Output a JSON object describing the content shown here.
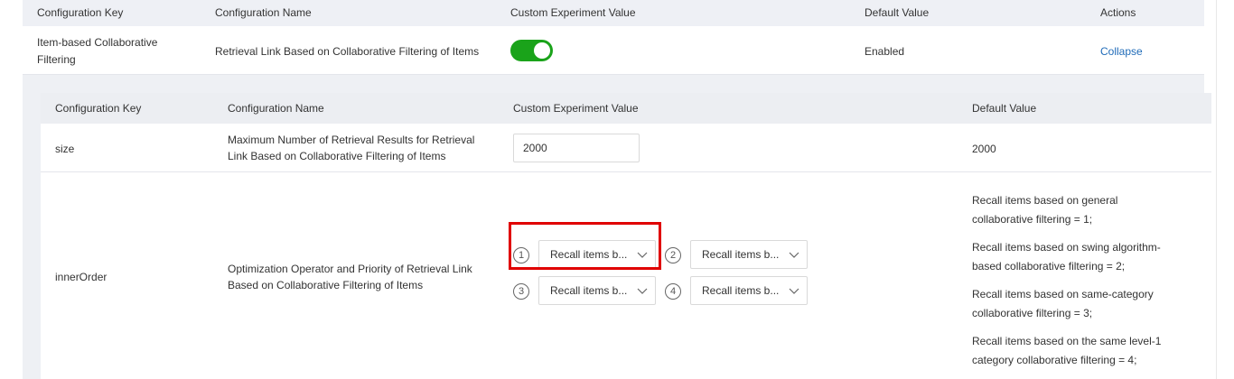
{
  "outer": {
    "headers": {
      "key": "Configuration Key",
      "name": "Configuration Name",
      "custom": "Custom Experiment Value",
      "default": "Default Value",
      "actions": "Actions"
    },
    "row": {
      "key_line1": "Item-based Collaborative",
      "key_line2": "Filtering",
      "name": "Retrieval Link Based on Collaborative Filtering of Items",
      "toggle_on": true,
      "default": "Enabled",
      "action": "Collapse"
    }
  },
  "inner": {
    "headers": {
      "key": "Configuration Key",
      "name": "Configuration Name",
      "custom": "Custom Experiment Value",
      "default": "Default Value"
    },
    "size_row": {
      "key": "size",
      "name_line1": "Maximum Number of Retrieval Results for Retrieval",
      "name_line2": "Link Based on Collaborative Filtering of Items",
      "value": "2000",
      "default": "2000"
    },
    "order_row": {
      "key": "innerOrder",
      "name_line1": "Optimization Operator and Priority of Retrieval Link",
      "name_line2": "Based on Collaborative Filtering of Items",
      "selects": [
        {
          "num": "1",
          "label": "Recall items b..."
        },
        {
          "num": "2",
          "label": "Recall items b..."
        },
        {
          "num": "3",
          "label": "Recall items b..."
        },
        {
          "num": "4",
          "label": "Recall items b..."
        }
      ],
      "default_lines": [
        "Recall items based on general",
        "collaborative filtering = 1;",
        "Recall items based on swing algorithm-",
        "based collaborative filtering = 2;",
        "Recall items based on same-category",
        "collaborative filtering = 3;",
        "Recall items based on the same level-1",
        "category collaborative filtering = 4;"
      ]
    }
  },
  "colors": {
    "toggle_on": "#1aa31a",
    "highlight": "#e00000",
    "link": "#1f6bb8"
  }
}
